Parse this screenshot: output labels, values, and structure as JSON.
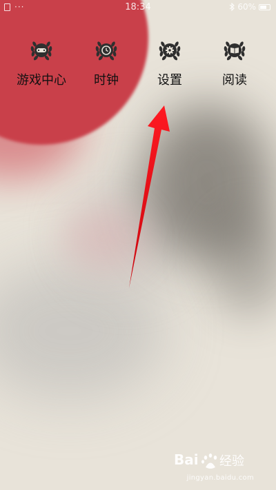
{
  "status_bar": {
    "dots": "···",
    "time": "18:34",
    "bluetooth_icon": "bluetooth-icon",
    "battery_percent": "60%"
  },
  "apps": [
    {
      "label": "游戏中心",
      "icon": "gamepad-icon"
    },
    {
      "label": "时钟",
      "icon": "clock-icon"
    },
    {
      "label": "设置",
      "icon": "gear-icon"
    },
    {
      "label": "阅读",
      "icon": "book-icon"
    }
  ],
  "annotation": {
    "arrow_color": "#e8101a",
    "points_to": "设置"
  },
  "watermark": {
    "brand": "Bai 经验",
    "url": "jingyan.baidu.com"
  },
  "colors": {
    "wallpaper_red": "#c9404a",
    "background": "#e8e3d9",
    "icon_dark": "#2f2f2f"
  }
}
